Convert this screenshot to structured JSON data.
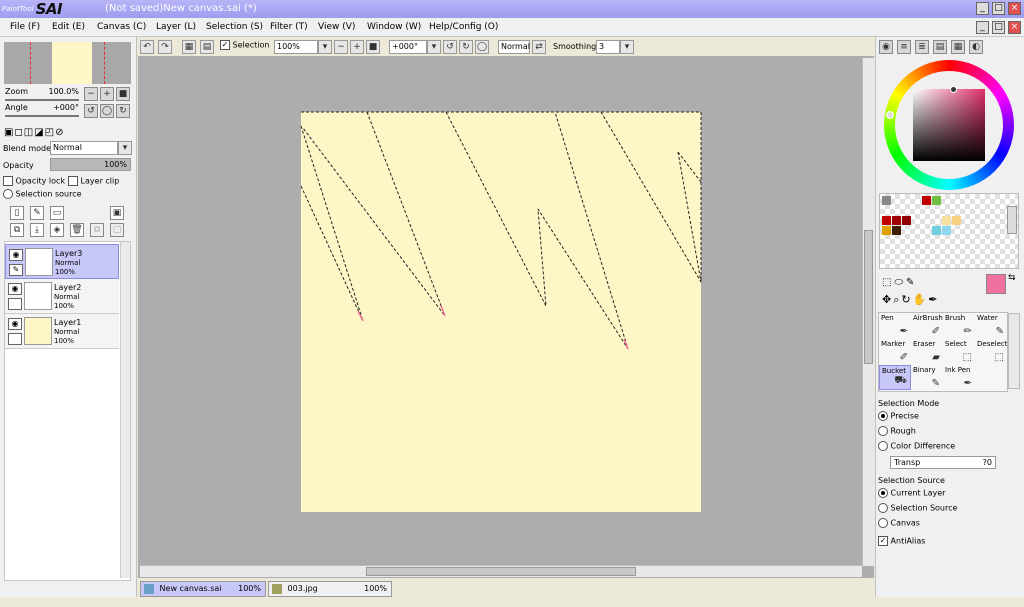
{
  "app": {
    "logo_small": "PaintTool",
    "logo_big": "SAI",
    "title": "(Not saved)New canvas.sai (*)"
  },
  "menu": [
    "File (F)",
    "Edit (E)",
    "Canvas (C)",
    "Layer (L)",
    "Selection (S)",
    "Filter (T)",
    "View (V)",
    "Window (W)",
    "Help/Config (O)"
  ],
  "toolbar": {
    "selection_label": "Selection",
    "zoom_value": "100%",
    "angle_value": "+000°",
    "mode_value": "Normal",
    "smoothing_label": "Smoothing",
    "smoothing_value": "3"
  },
  "navigator": {
    "zoom_label": "Zoom",
    "zoom_value": "100.0%",
    "angle_label": "Angle",
    "angle_value": "+000°"
  },
  "layer_panel": {
    "blend_mode_label": "Blend mode",
    "blend_mode_value": "Normal",
    "opacity_label": "Opacity",
    "opacity_value": "100%",
    "opacity_lock": "Opacity lock",
    "layer_clip": "Layer clip",
    "selection_source": "Selection source",
    "layers": [
      {
        "name": "Layer3",
        "mode": "Normal",
        "opacity": "100%",
        "active": true
      },
      {
        "name": "Layer2",
        "mode": "Normal",
        "opacity": "100%",
        "active": false
      },
      {
        "name": "Layer1",
        "mode": "Normal",
        "opacity": "100%",
        "active": false
      }
    ]
  },
  "tabs": [
    {
      "name": "New canvas.sai",
      "zoom": "100%"
    },
    {
      "name": "003.jpg",
      "zoom": "100%"
    }
  ],
  "colors": {
    "canvas": "#fff6c8",
    "primary": "#f070a0",
    "active_bg": "#c8c8f8"
  },
  "tools": {
    "items": [
      "Pen",
      "AirBrush",
      "Brush",
      "Water",
      "Marker",
      "Eraser",
      "Select",
      "Deselect",
      "Bucket",
      "Binary",
      "Ink Pen"
    ]
  },
  "tool_options": {
    "selection_mode_label": "Selection Mode",
    "modes": [
      "Precise",
      "Rough",
      "Color Difference"
    ],
    "transp_label": "Transp",
    "transp_value": "?0",
    "selection_source_label": "Selection Source",
    "sources": [
      "Current Layer",
      "Selection Source",
      "Canvas"
    ],
    "antialias": "AntiAlias"
  }
}
